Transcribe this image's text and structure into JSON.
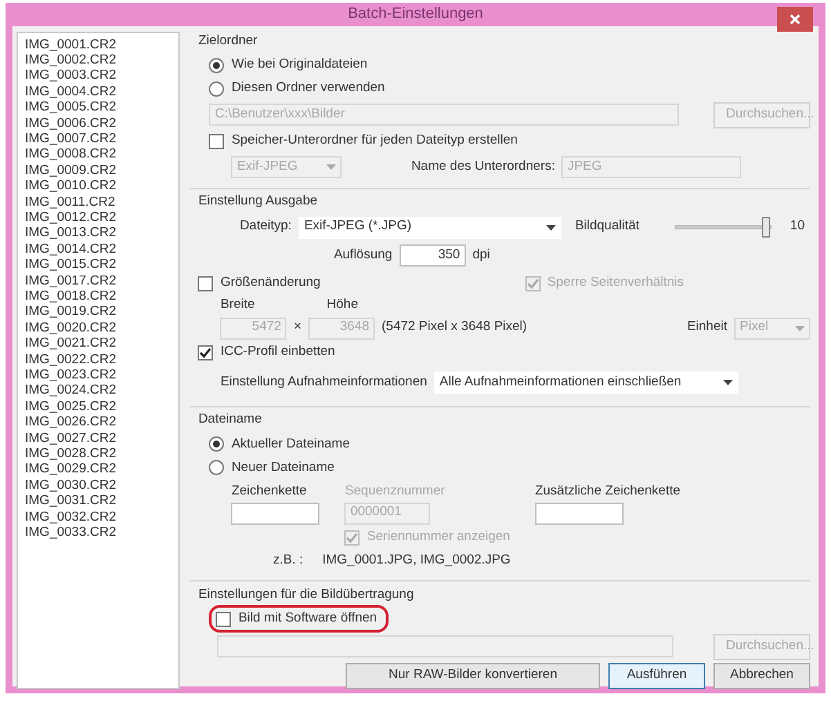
{
  "window": {
    "title": "Batch-Einstellungen"
  },
  "files": [
    {
      "name": "IMG_0001.CR2"
    },
    {
      "name": "IMG_0002.CR2"
    },
    {
      "name": "IMG_0003.CR2"
    },
    {
      "name": "IMG_0004.CR2"
    },
    {
      "name": "IMG_0005.CR2"
    },
    {
      "name": "IMG_0006.CR2"
    },
    {
      "name": "IMG_0007.CR2"
    },
    {
      "name": "IMG_0008.CR2"
    },
    {
      "name": "IMG_0009.CR2"
    },
    {
      "name": "IMG_0010.CR2"
    },
    {
      "name": "IMG_0011.CR2"
    },
    {
      "name": "IMG_0012.CR2"
    },
    {
      "name": "IMG_0013.CR2"
    },
    {
      "name": "IMG_0014.CR2"
    },
    {
      "name": "IMG_0015.CR2"
    },
    {
      "name": "IMG_0017.CR2"
    },
    {
      "name": "IMG_0018.CR2"
    },
    {
      "name": "IMG_0019.CR2"
    },
    {
      "name": "IMG_0020.CR2"
    },
    {
      "name": "IMG_0021.CR2"
    },
    {
      "name": "IMG_0022.CR2"
    },
    {
      "name": "IMG_0023.CR2"
    },
    {
      "name": "IMG_0024.CR2"
    },
    {
      "name": "IMG_0025.CR2"
    },
    {
      "name": "IMG_0026.CR2"
    },
    {
      "name": "IMG_0027.CR2"
    },
    {
      "name": "IMG_0028.CR2"
    },
    {
      "name": "IMG_0029.CR2"
    },
    {
      "name": "IMG_0030.CR2"
    },
    {
      "name": "IMG_0031.CR2"
    },
    {
      "name": "IMG_0032.CR2"
    },
    {
      "name": "IMG_0033.CR2"
    }
  ],
  "destination": {
    "heading": "Zielordner",
    "options": [
      {
        "label": "Wie bei Originaldateien",
        "selected": true
      },
      {
        "label": "Diesen Ordner verwenden",
        "selected": false
      }
    ],
    "path": {
      "value": "C:\\Benutzer\\xxx\\Bilder",
      "disabled": true
    },
    "browse": {
      "label": "Durchsuchen...",
      "disabled": true
    },
    "subfolder": {
      "label": "Speicher-Unterordner für jeden Dateityp erstellen",
      "checked": false,
      "disabled": false
    },
    "subfolder_type": {
      "value": "Exif-JPEG",
      "disabled": true
    },
    "subfolder_name": {
      "label": "Name des Unterordners:",
      "value": "JPEG",
      "disabled": true
    }
  },
  "output": {
    "heading": "Einstellung Ausgabe",
    "file_type": {
      "label": "Dateityp:",
      "value": "Exif-JPEG (*.JPG)"
    },
    "quality": {
      "label": "Bildqualität",
      "level": 1,
      "reading": "10"
    },
    "resolution": {
      "label": "Auflösung",
      "value": "350",
      "unit": "dpi"
    },
    "resize": {
      "label": "Größenänderung",
      "checked": false,
      "disabled": false
    },
    "keep_ratio": {
      "label": "Sperre Seitenverhältnis",
      "checked": true,
      "disabled": true
    },
    "width": {
      "label": "Breite",
      "value": "5472",
      "disabled": true
    },
    "times": "×",
    "height": {
      "label": "Höhe",
      "value": "3648",
      "disabled": true
    },
    "size_info": "(5472 Pixel x 3648 Pixel)",
    "unit": {
      "label": "Einheit",
      "value": "Pixel",
      "disabled": true
    },
    "icc": {
      "label": "ICC-Profil einbetten",
      "checked": true,
      "disabled": false
    },
    "shooting_info": {
      "label": "Einstellung Aufnahmeinformationen",
      "value": "Alle Aufnahmeinformationen einschließen"
    }
  },
  "filename": {
    "heading": "Dateiname",
    "options": [
      {
        "label": "Aktueller Dateiname",
        "selected": true
      },
      {
        "label": "Neuer Dateiname",
        "selected": false
      }
    ],
    "string": {
      "label": "Zeichenkette",
      "disabled": false
    },
    "sequence": {
      "label": "Sequenznummer",
      "value": "0000001",
      "disabled": true
    },
    "extra": {
      "label": "Zusätzliche Zeichenkette",
      "disabled": false
    },
    "serial": {
      "label": "Seriennummer anzeigen",
      "checked": true,
      "disabled": true
    },
    "example_label": "z.B. :",
    "example": "IMG_0001.JPG, IMG_0002.JPG"
  },
  "transfer": {
    "heading": "Einstellungen für die Bildübertragung",
    "open_with": {
      "label": "Bild mit Software öffnen",
      "checked": false,
      "disabled": false,
      "highlighted": true
    },
    "path": {
      "disabled": true
    },
    "browse": {
      "label": "Durchsuchen...",
      "disabled": true
    }
  },
  "buttons": [
    {
      "label": "Nur RAW-Bilder konvertieren",
      "default": false
    },
    {
      "label": "Ausführen",
      "default": true
    },
    {
      "label": "Abbrechen",
      "default": false
    }
  ]
}
